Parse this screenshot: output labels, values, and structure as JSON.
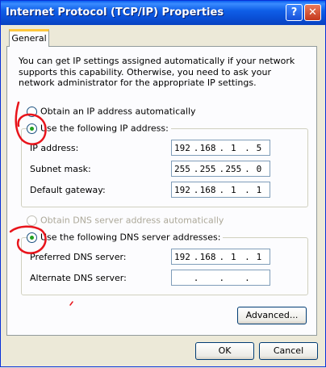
{
  "window": {
    "title": "Internet Protocol (TCP/IP) Properties",
    "help_glyph": "?",
    "close_glyph": "✕"
  },
  "tabs": [
    {
      "label": "General",
      "selected": true
    }
  ],
  "intro_text": "You can get IP settings assigned automatically if your network supports this capability. Otherwise, you need to ask your network administrator for the appropriate IP settings.",
  "ip_mode": {
    "auto": {
      "label": "Obtain an IP address automatically",
      "checked": false
    },
    "manual": {
      "label": "Use the following IP address:",
      "checked": true
    }
  },
  "ip_fields": [
    {
      "label": "IP address:",
      "octets": [
        "192",
        "168",
        "1",
        "5"
      ]
    },
    {
      "label": "Subnet mask:",
      "octets": [
        "255",
        "255",
        "255",
        "0"
      ]
    },
    {
      "label": "Default gateway:",
      "octets": [
        "192",
        "168",
        "1",
        "1"
      ]
    }
  ],
  "dns_mode": {
    "auto": {
      "label": "Obtain DNS server address automatically",
      "checked": false,
      "enabled": false
    },
    "manual": {
      "label": "Use the following DNS server addresses:",
      "checked": true
    }
  },
  "dns_fields": [
    {
      "label": "Preferred DNS server:",
      "octets": [
        "192",
        "168",
        "1",
        "1"
      ]
    },
    {
      "label": "Alternate DNS server:",
      "octets": [
        "",
        "",
        "",
        ""
      ]
    }
  ],
  "buttons": {
    "advanced": "Advanced...",
    "ok": "OK",
    "cancel": "Cancel"
  },
  "annotation_color": "#e8141b"
}
